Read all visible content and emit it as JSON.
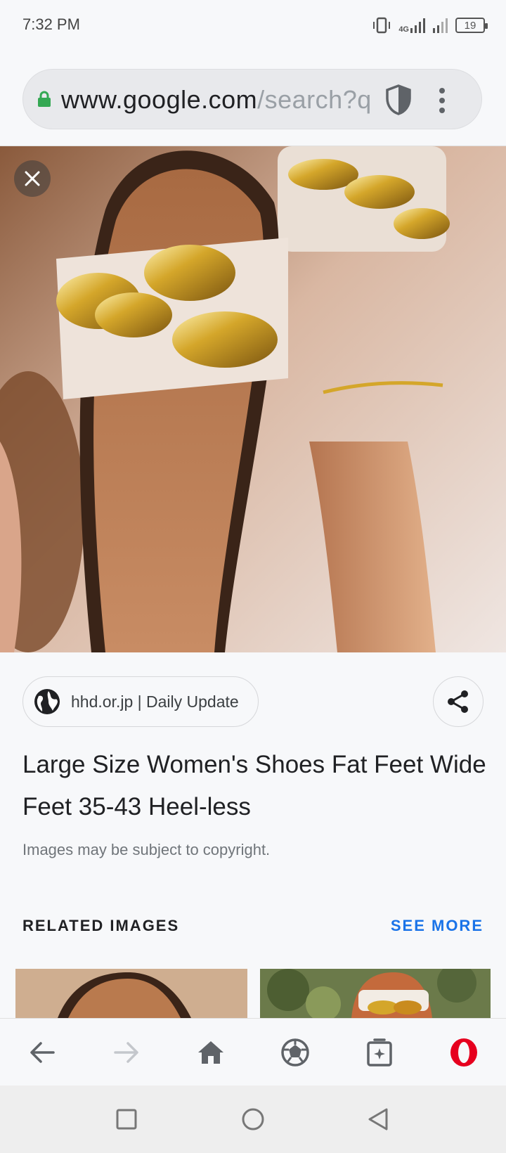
{
  "status_bar": {
    "time": "7:32 PM",
    "network": "4G",
    "battery": "19"
  },
  "url_bar": {
    "domain": "www.google.com",
    "path": "/search?q",
    "icons": [
      "lock-icon",
      "shield-icon",
      "more-vert-icon"
    ]
  },
  "image_viewer": {
    "close_icon": "close-icon",
    "source": "hhd.or.jp | Daily Update",
    "title": "Large Size Women's Shoes Fat Feet Wide Feet 35-43 Heel-less",
    "copyright": "Images may be subject to copyright."
  },
  "related": {
    "label": "RELATED IMAGES",
    "see_more": "SEE MORE"
  },
  "toolbar": {
    "icons": [
      "back-icon",
      "forward-icon",
      "home-icon",
      "speed-dial-icon",
      "tabs-icon",
      "opera-menu-icon"
    ]
  },
  "colors": {
    "accent": "#1a73e8",
    "opera_red": "#e6001e",
    "lock_green": "#34a853"
  }
}
